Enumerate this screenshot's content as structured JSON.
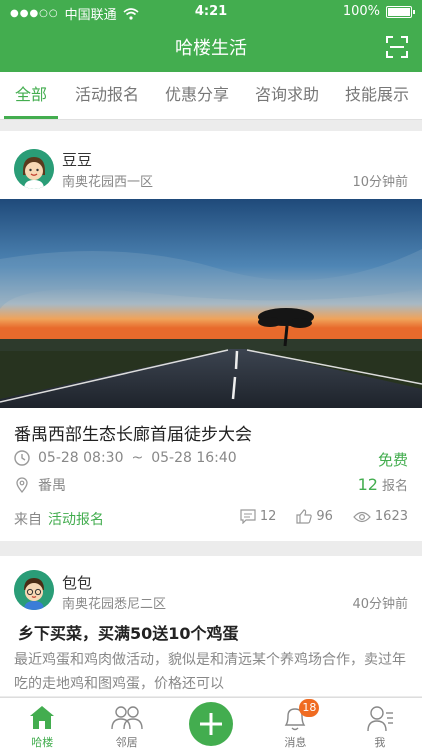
{
  "status_bar": {
    "carrier": "中国联通",
    "time": "4:21",
    "battery": "100%"
  },
  "nav": {
    "title": "哈楼生活"
  },
  "tabs": [
    {
      "label": "全部",
      "active": true
    },
    {
      "label": "活动报名",
      "active": false
    },
    {
      "label": "优惠分享",
      "active": false
    },
    {
      "label": "咨询求助",
      "active": false
    },
    {
      "label": "技能展示",
      "active": false
    }
  ],
  "event_post": {
    "author": "豆豆",
    "community": "南奥花园西一区",
    "time_ago": "10分钟前",
    "title": "番禺西部生态长廊首届徒步大会",
    "start": "05-28 08:30",
    "separator": "~",
    "end": "05-28 16:40",
    "location": "番禺",
    "price": "免费",
    "signup_count": "12",
    "signup_label": "报名",
    "from_label": "来自",
    "category": "活动报名",
    "comments": "12",
    "likes": "96",
    "views": "1623"
  },
  "text_post": {
    "author": "包包",
    "community": "南奥花园悉尼二区",
    "time_ago": "40分钟前",
    "title": "乡下买菜，买满50送10个鸡蛋",
    "body": "最近鸡蛋和鸡肉做活动，貌似是和清远某个养鸡场合作，卖过年吃的走地鸡和图鸡蛋，价格还可以"
  },
  "bottom_nav": [
    {
      "label": "哈楼",
      "icon": "home-icon",
      "active": true
    },
    {
      "label": "邻居",
      "icon": "neighbors-icon",
      "active": false
    },
    {
      "label": "",
      "icon": "plus-icon",
      "active": false
    },
    {
      "label": "消息",
      "icon": "bell-icon",
      "badge": "18",
      "active": false
    },
    {
      "label": "我",
      "icon": "profile-icon",
      "active": false
    }
  ],
  "colors": {
    "brand": "#43ad4f",
    "badge": "#f06b21"
  }
}
